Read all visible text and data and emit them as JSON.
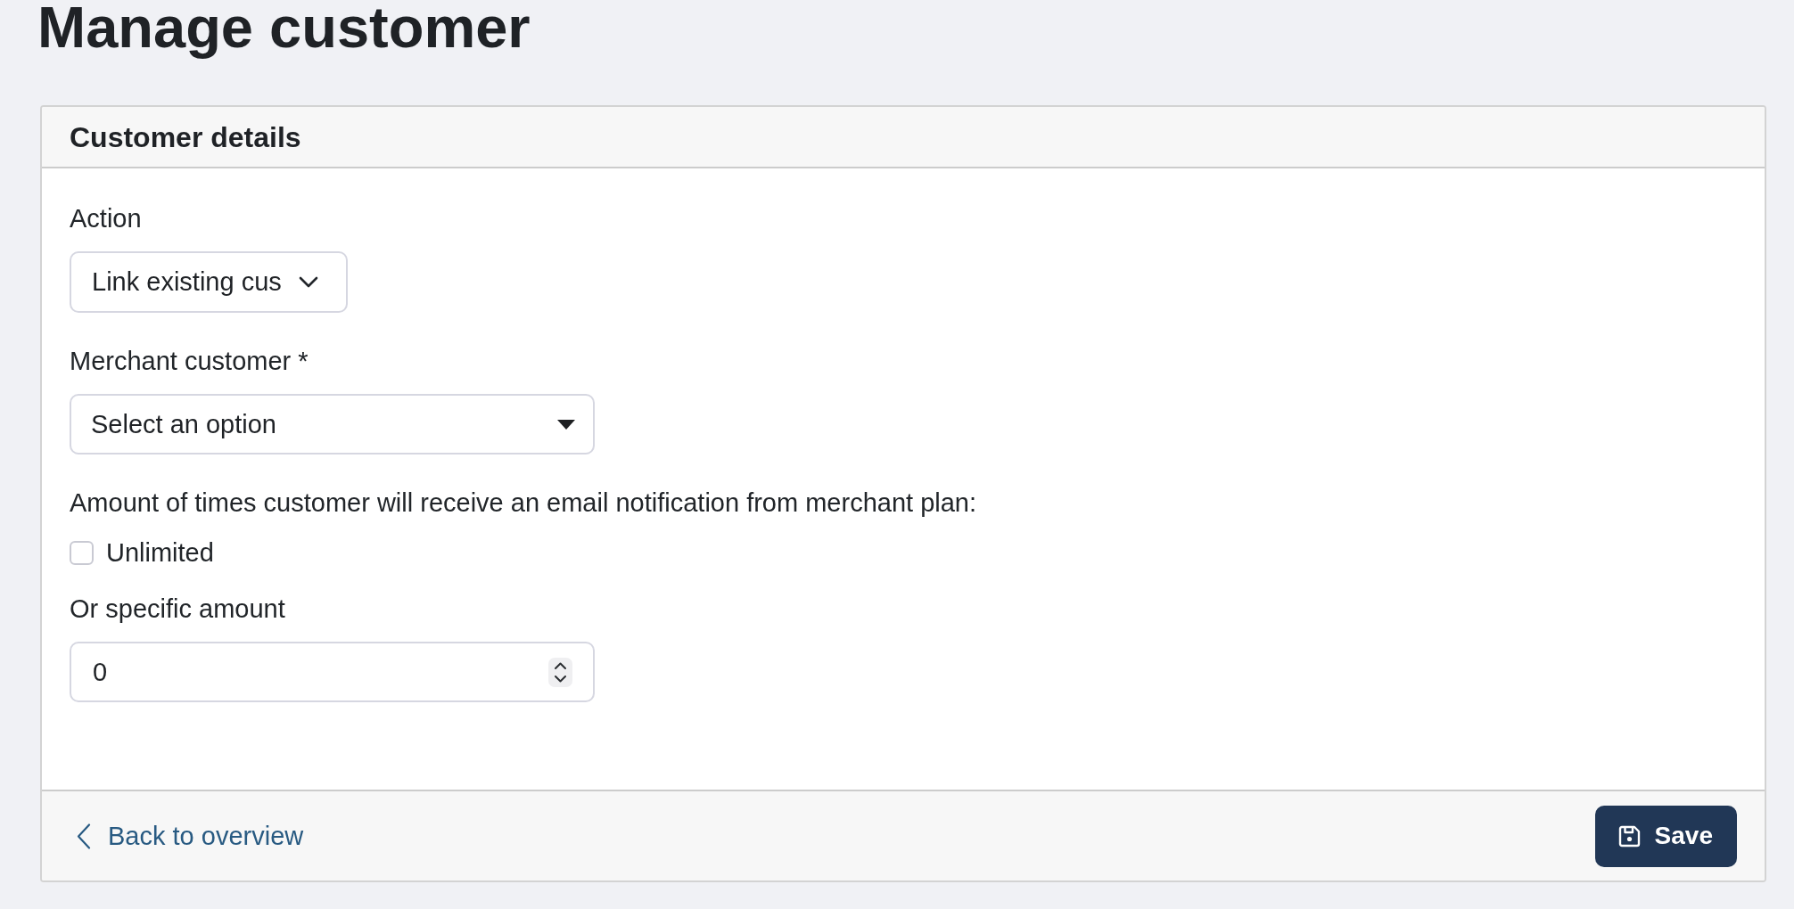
{
  "page": {
    "title": "Manage customer"
  },
  "card": {
    "title": "Customer details",
    "fields": [
      {
        "kind": "dropdown",
        "label": "Action",
        "value": "Link existing cus"
      },
      {
        "kind": "select",
        "label": "Merchant customer *",
        "placeholder": "Select an option"
      },
      {
        "kind": "note",
        "text": "Amount of times customer will receive an email notification from merchant plan:"
      },
      {
        "kind": "checkbox",
        "label": "Unlimited",
        "checked": false
      },
      {
        "kind": "number",
        "label": "Or specific amount",
        "value": "0"
      }
    ],
    "footer": {
      "back_link": {
        "label": "Back to overview"
      },
      "save_button": {
        "label": "Save"
      }
    }
  }
}
